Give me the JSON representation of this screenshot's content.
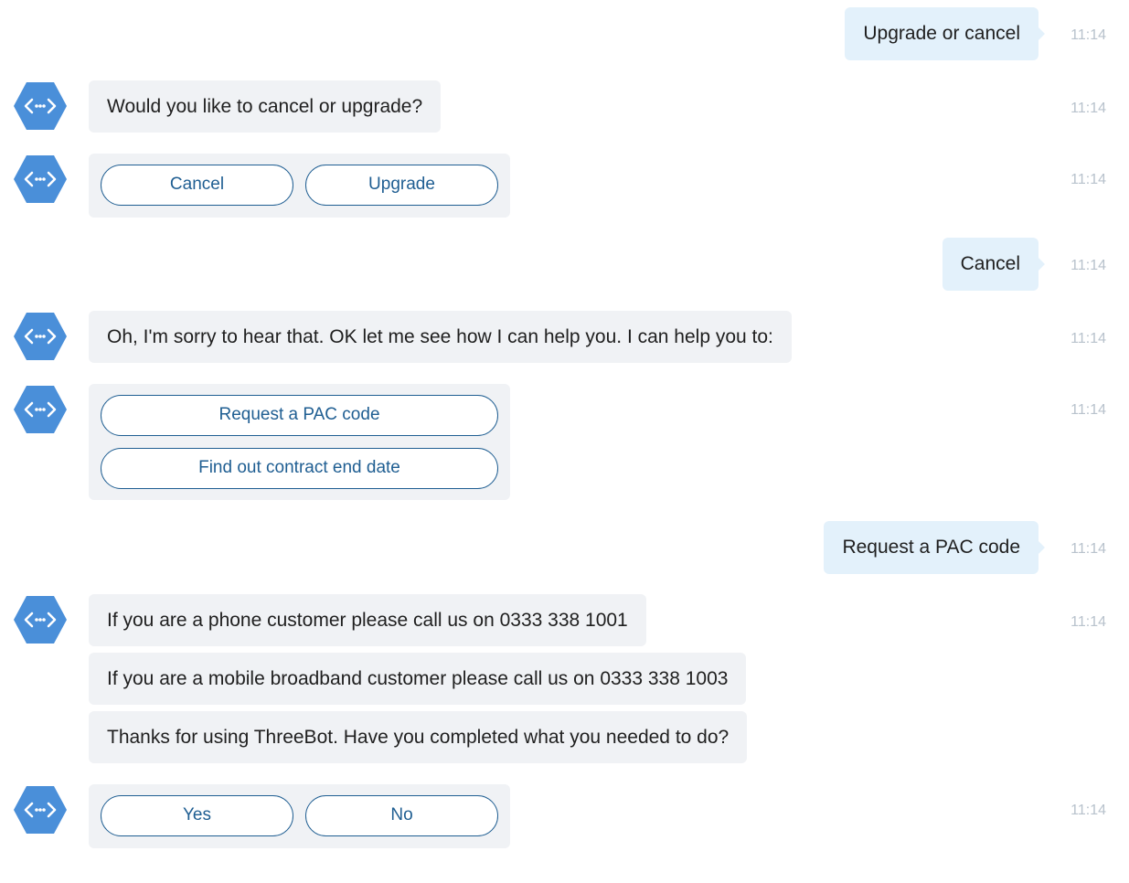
{
  "timestamp": "11:14",
  "messages": {
    "user1": "Upgrade or cancel",
    "bot1": "Would you like to cancel or upgrade?",
    "choices1": [
      "Cancel",
      "Upgrade"
    ],
    "user2": "Cancel",
    "bot2": "Oh, I'm sorry to hear that. OK let me see how I can help you. I can help you to:",
    "choices2": [
      "Request a PAC code",
      "Find out contract end date"
    ],
    "user3": "Request a PAC code",
    "bot3a": "If you are a phone customer please call us on 0333 338 1001",
    "bot3b": "If you are a mobile broadband customer please call us on 0333 338 1003",
    "bot3c": "Thanks for using ThreeBot. Have you completed what you needed to do?",
    "choices3": [
      "Yes",
      "No"
    ]
  },
  "colors": {
    "user_bubble": "#e3f1fb",
    "bot_bubble": "#f0f2f5",
    "button_border": "#1f5e92",
    "avatar": "#4a8fd9",
    "timestamp": "#b8c2cc"
  },
  "icons": {
    "bot_avatar": "hexagon-code-icon"
  }
}
